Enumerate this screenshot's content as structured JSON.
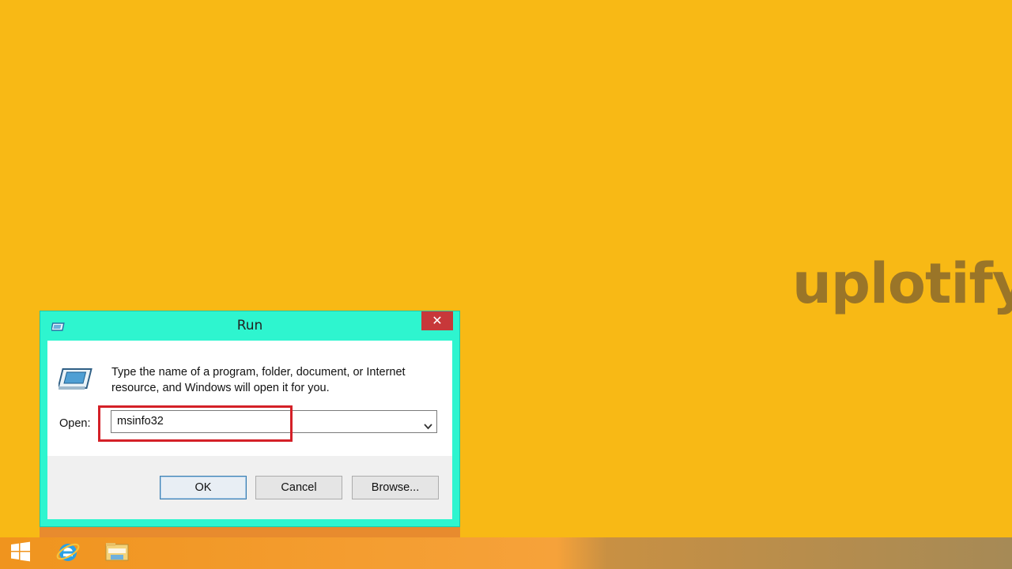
{
  "watermark": {
    "text": "uplotify"
  },
  "dialog": {
    "title": "Run",
    "close_label": "✕",
    "description_line1": "Type the name of a program, folder, document, or Internet",
    "description_line2": "resource, and Windows will open it for you.",
    "open_label": "Open:",
    "open_value": "msinfo32",
    "buttons": {
      "ok": "OK",
      "cancel": "Cancel",
      "browse": "Browse..."
    }
  },
  "taskbar": {
    "items": [
      {
        "icon": "windows-start-icon"
      },
      {
        "icon": "internet-explorer-icon"
      },
      {
        "icon": "file-explorer-icon"
      }
    ]
  },
  "colors": {
    "desktop": "#f8b915",
    "dialog_frame": "#2ef5cf",
    "close_button": "#c7383a",
    "highlight": "#d42027"
  }
}
